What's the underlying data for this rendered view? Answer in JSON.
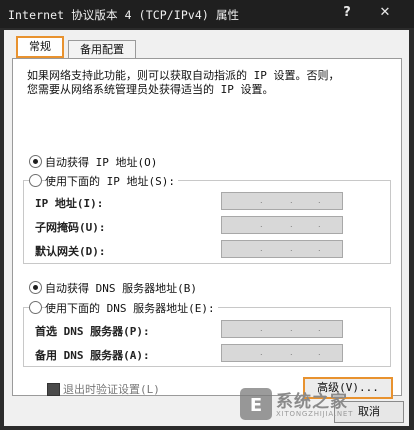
{
  "window": {
    "title": "Internet 协议版本 4 (TCP/IPv4) 属性",
    "help_glyph": "?",
    "close_glyph": "✕"
  },
  "tabs": [
    {
      "label": "常规",
      "selected": true
    },
    {
      "label": "备用配置",
      "selected": false
    }
  ],
  "description": {
    "line1": "如果网络支持此功能，则可以获取自动指派的 IP 设置。否则，",
    "line2": "您需要从网络系统管理员处获得适当的 IP 设置。"
  },
  "ip_section": {
    "auto_label": "自动获得 IP 地址(O)",
    "auto_selected": true,
    "manual_label": "使用下面的 IP 地址(S):",
    "fields": [
      {
        "label": "IP 地址(I):"
      },
      {
        "label": "子网掩码(U):"
      },
      {
        "label": "默认网关(D):"
      }
    ]
  },
  "dns_section": {
    "auto_label": "自动获得 DNS 服务器地址(B)",
    "auto_selected": true,
    "manual_label": "使用下面的 DNS 服务器地址(E):",
    "fields": [
      {
        "label": "首选 DNS 服务器(P):"
      },
      {
        "label": "备用 DNS 服务器(A):"
      }
    ]
  },
  "validate_label": "退出时验证设置(L)",
  "buttons": {
    "advanced": "高级(V)...",
    "cancel": "取消"
  },
  "watermark": {
    "text": "系统之家",
    "url": "XITONGZHIJIA.NET"
  }
}
